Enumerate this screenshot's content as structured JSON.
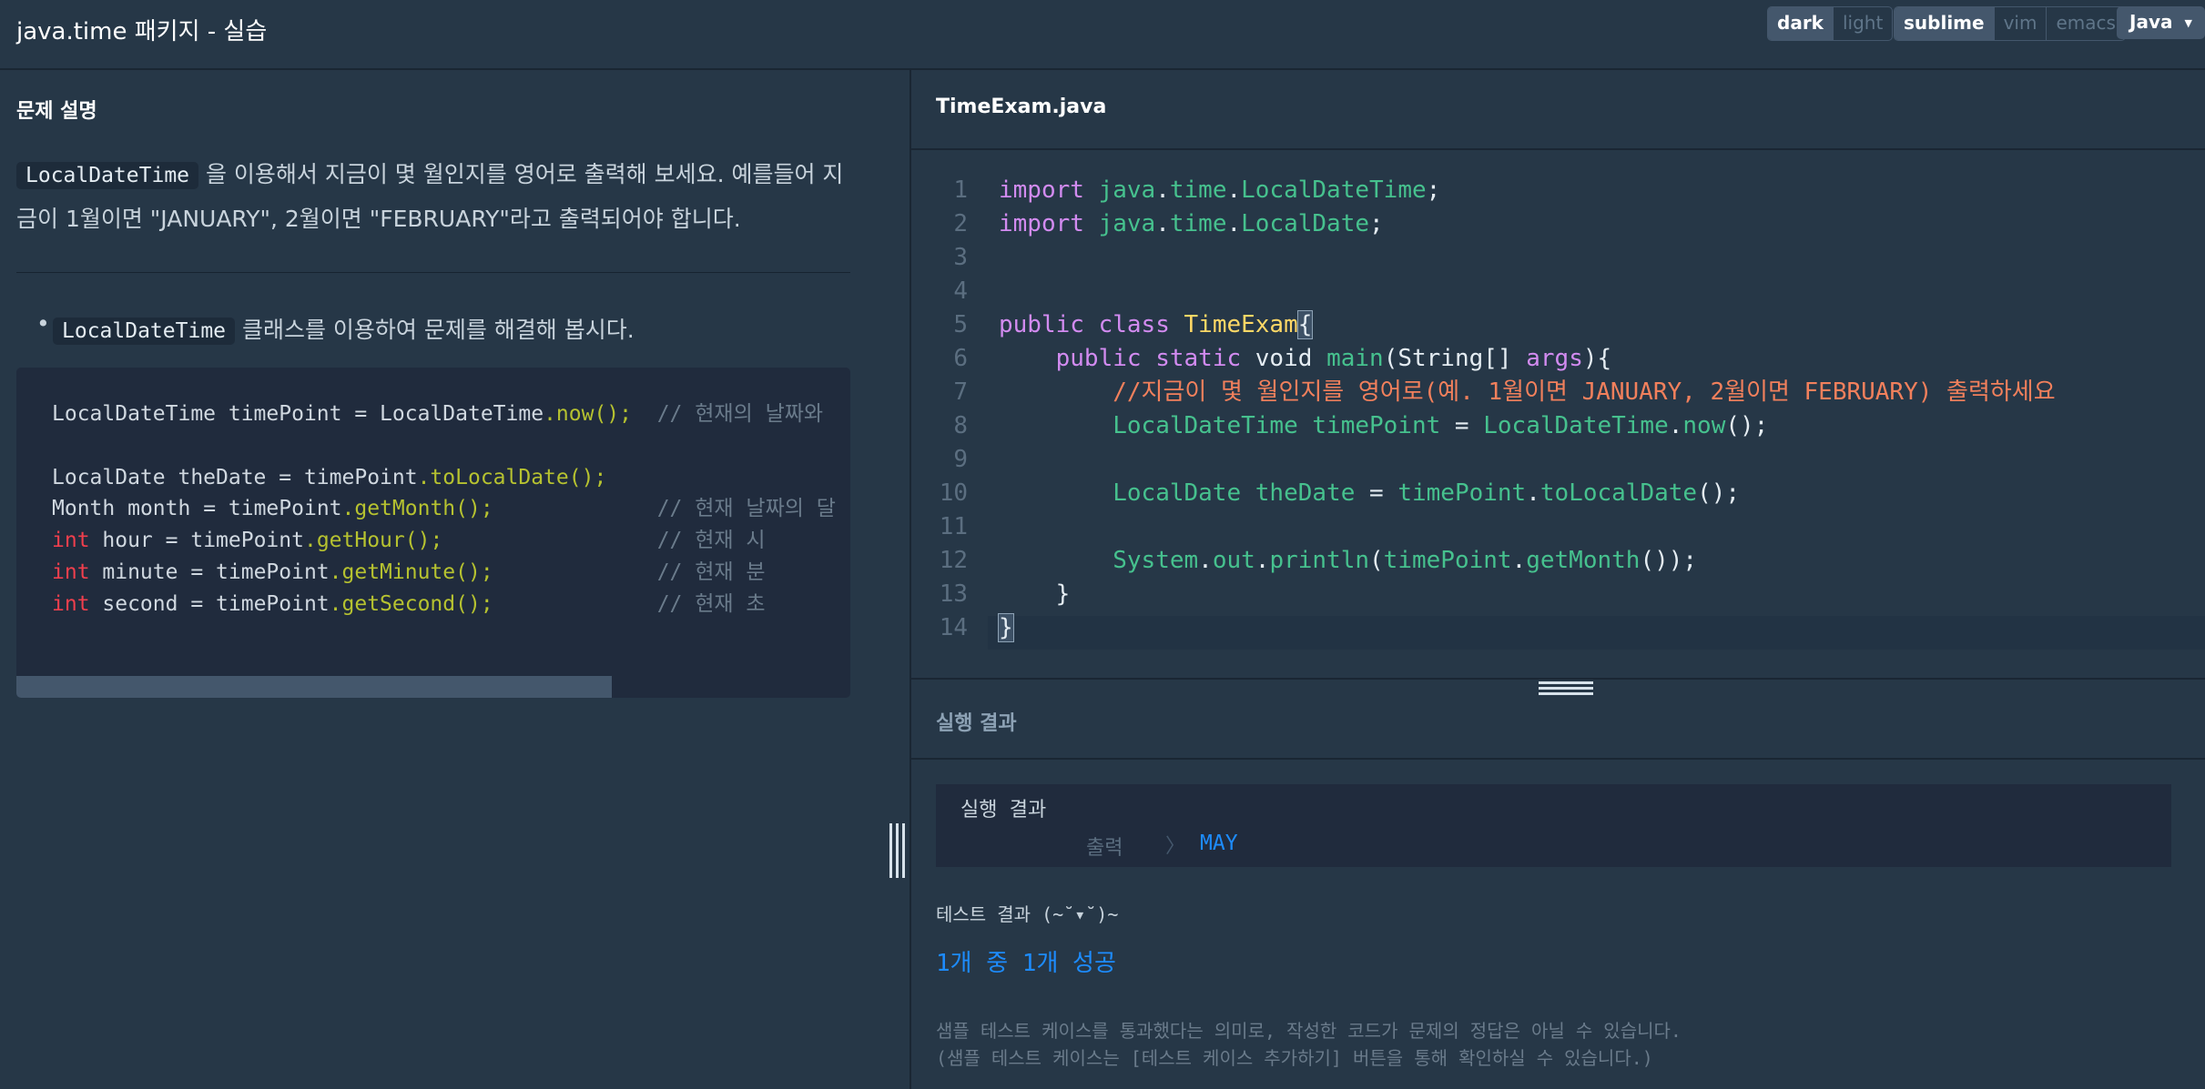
{
  "header": {
    "title": "java.time 패키지 - 실습",
    "theme_options": [
      "dark",
      "light"
    ],
    "theme_selected": "dark",
    "keymap_options": [
      "sublime",
      "vim",
      "emacs"
    ],
    "keymap_selected": "sublime",
    "language": "Java"
  },
  "description": {
    "heading": "문제 설명",
    "chip1": "LocalDateTime",
    "para_rest": " 을 이용해서 지금이 몇 월인지를 영어로 출력해 보세요. 예를들어 지금이 1월이면 \"JANUARY\", 2월이면 \"FEBRUARY\"라고 출력되어야 합니다.",
    "hint_chip": "LocalDateTime",
    "hint_rest": " 클래스를 이용하여 문제를 해결해 봅시다.",
    "example_lines": [
      {
        "type": "LocalDateTime",
        "var": " timePoint ",
        "rhs": "LocalDateTime",
        "call": ".now",
        "comment": "// 현재의 날짜와"
      },
      {
        "type": "LocalDate",
        "var": " theDate ",
        "rhs": "timePoint",
        "call": ".toLocalDate",
        "comment": ""
      },
      {
        "type": "Month",
        "var": " month ",
        "rhs": "timePoint",
        "call": ".getMonth",
        "comment": "// 현재 날짜의 달"
      },
      {
        "type": "int",
        "var": " hour ",
        "rhs": "timePoint",
        "call": ".getHour",
        "comment": "// 현재 시"
      },
      {
        "type": "int",
        "var": " minute ",
        "rhs": "timePoint",
        "call": ".getMinute",
        "comment": "// 현재 분"
      },
      {
        "type": "int",
        "var": " second ",
        "rhs": "timePoint",
        "call": ".getSecond",
        "comment": "// 현재 초"
      }
    ]
  },
  "editor": {
    "file_name": "TimeExam.java",
    "line_numbers": [
      "1",
      "2",
      "3",
      "4",
      "5",
      "6",
      "7",
      "8",
      "9",
      "10",
      "11",
      "12",
      "13",
      "14"
    ],
    "code": {
      "import_kw": "import",
      "pkg_java": "java",
      "pkg_time": "time",
      "cls_localdatetime": "LocalDateTime",
      "cls_localdate": "LocalDate",
      "kw_public": "public",
      "kw_class": "class",
      "kw_static": "static",
      "kw_void": "void",
      "cls_name": "TimeExam",
      "fn_main": "main",
      "type_string": "String",
      "arg_args": "args",
      "comment": "//지금이 몇 월인지를 영어로(예. 1월이면 JANUARY, 2월이면 FEBRUARY) 출력하세요",
      "var_timepoint": "timePoint",
      "fn_now": "now",
      "var_thedate": "theDate",
      "fn_tolocaldate": "toLocalDate",
      "cls_system": "System",
      "fld_out": "out",
      "fn_println": "println",
      "fn_getmonth": "getMonth"
    }
  },
  "result": {
    "heading": "실행 결과",
    "box_label": "실행 결과",
    "output_label": "출력",
    "output_chevron": "〉",
    "output_value": "MAY",
    "test_title": "테스트 결과 (~˘▾˘)~",
    "test_score": "1개 중 1개 성공",
    "note1": "샘플 테스트 케이스를 통과했다는 의미로, 작성한 코드가 문제의 정답은 아닐 수 있습니다.",
    "note2": "(샘플 테스트 케이스는 [테스트 케이스 추가하기] 버튼을 통해 확인하실 수 있습니다.)"
  }
}
